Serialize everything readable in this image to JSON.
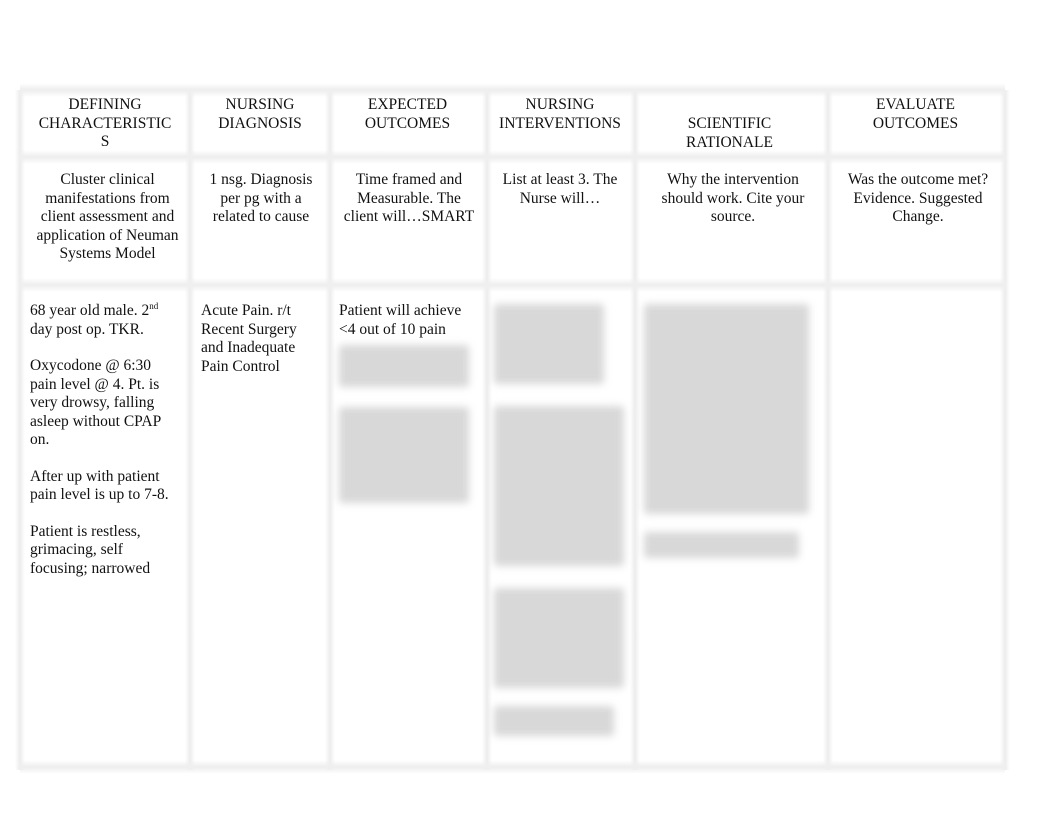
{
  "table": {
    "headers": [
      "DEFINING CHARACTERISTIC S",
      "NURSING DIAGNOSIS",
      "EXPECTED OUTCOMES",
      "NURSING INTERVENTIONS",
      "SCIENTIFIC RATIONALE",
      "EVALUATE OUTCOMES"
    ],
    "header_lines": [
      [
        "DEFINING",
        "CHARACTERISTIC",
        "S"
      ],
      [
        "NURSING",
        "DIAGNOSIS"
      ],
      [
        "EXPECTED",
        "OUTCOMES"
      ],
      [
        "NURSING",
        "INTERVENTIONS"
      ],
      [
        "SCIENTIFIC",
        "RATIONALE"
      ],
      [
        "EVALUATE",
        "OUTCOMES"
      ]
    ],
    "instructions": [
      "Cluster clinical manifestations from client assessment and application of Neuman Systems Model",
      "1 nsg. Diagnosis per pg with a related to cause",
      "Time framed and Measurable. The client will…SMART",
      "List at least 3. The Nurse will…",
      "Why the intervention should work. Cite your source.",
      "Was the outcome met? Evidence. Suggested Change."
    ],
    "row": {
      "defining_characteristics": {
        "p1_main": "68 year old male. 2",
        "p1_sup": "nd",
        "p1_rest": " day post op. TKR.",
        "p2": "Oxycodone @ 6:30 pain level @ 4. Pt. is very drowsy, falling asleep without CPAP on.",
        "p3": "After up with patient pain level is up to 7-8.",
        "p4": "Patient is restless, grimacing, self focusing; narrowed"
      },
      "nursing_diagnosis": "Acute Pain. r/t Recent Surgery and Inadequate Pain Control",
      "expected_outcome_visible": "Patient will achieve <4 out of 10 pain",
      "expected_outcome_blurred": "[blurred text]",
      "interventions_blurred": "[blurred text]",
      "rationale_blurred": "[blurred text]",
      "evaluation": ""
    }
  }
}
